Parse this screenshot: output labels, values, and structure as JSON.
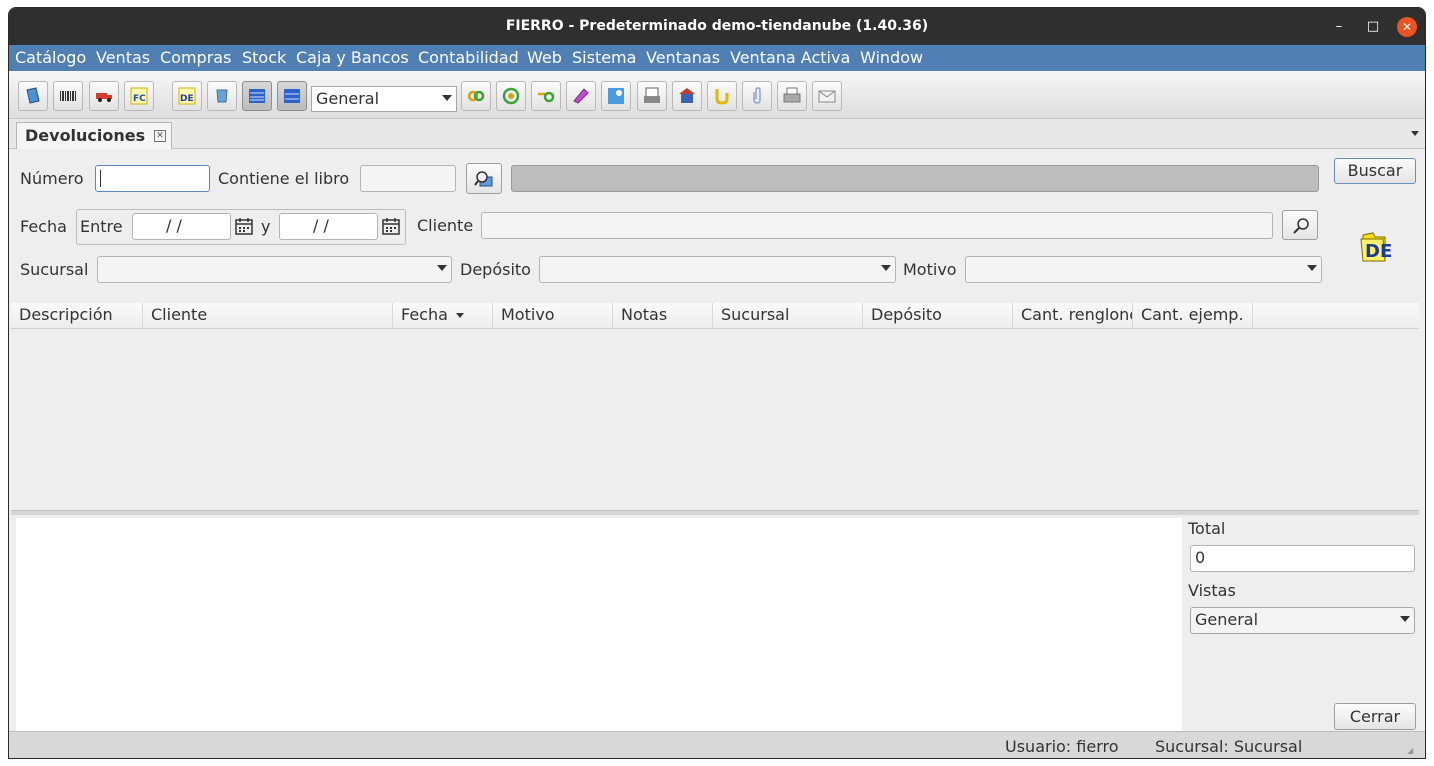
{
  "window": {
    "title": "FIERRO - Predeterminado demo-tiendanube (1.40.36)"
  },
  "menu": [
    "Catálogo",
    "Ventas",
    "Compras",
    "Stock",
    "Caja y Bancos",
    "Contabilidad",
    "Web",
    "Sistema",
    "Ventanas",
    "Ventana Activa",
    "Window"
  ],
  "toolbar": {
    "view_combo_value": "General",
    "buttons": [
      "book-icon",
      "barcode-icon",
      "truck-icon",
      "invoice-fc-icon",
      "returns-de-icon",
      "shield-icon",
      "list-view-icon",
      "list-view-alt-icon",
      "link-icon",
      "target-icon",
      "connector-icon",
      "eraser-icon",
      "search-image-icon",
      "print-preview-icon",
      "store-icon",
      "hook-icon",
      "paperclip-icon",
      "printer-icon",
      "mail-icon"
    ]
  },
  "tab": {
    "label": "Devoluciones"
  },
  "filters": {
    "numero_label": "Número",
    "numero_value": "",
    "contiene_label": "Contiene el libro",
    "fecha_label": "Fecha",
    "entre_label": "Entre",
    "fecha_desde": "/ /",
    "y_label": "y",
    "fecha_hasta": "/ /",
    "cliente_label": "Cliente",
    "sucursal_label": "Sucursal",
    "deposito_label": "Depósito",
    "motivo_label": "Motivo",
    "buscar_label": "Buscar",
    "module_badge": "DE"
  },
  "table": {
    "columns": [
      "Descripción",
      "Cliente",
      "Fecha",
      "Motivo",
      "Notas",
      "Sucursal",
      "Depósito",
      "Cant. renglones",
      "Cant. ejemp."
    ],
    "sorted_column": "Fecha",
    "rows": []
  },
  "summary": {
    "total_label": "Total",
    "total_value": "0",
    "vistas_label": "Vistas",
    "vistas_value": "General",
    "cerrar_label": "Cerrar"
  },
  "status": {
    "usuario": "Usuario: fierro",
    "sucursal": "Sucursal: Sucursal"
  }
}
